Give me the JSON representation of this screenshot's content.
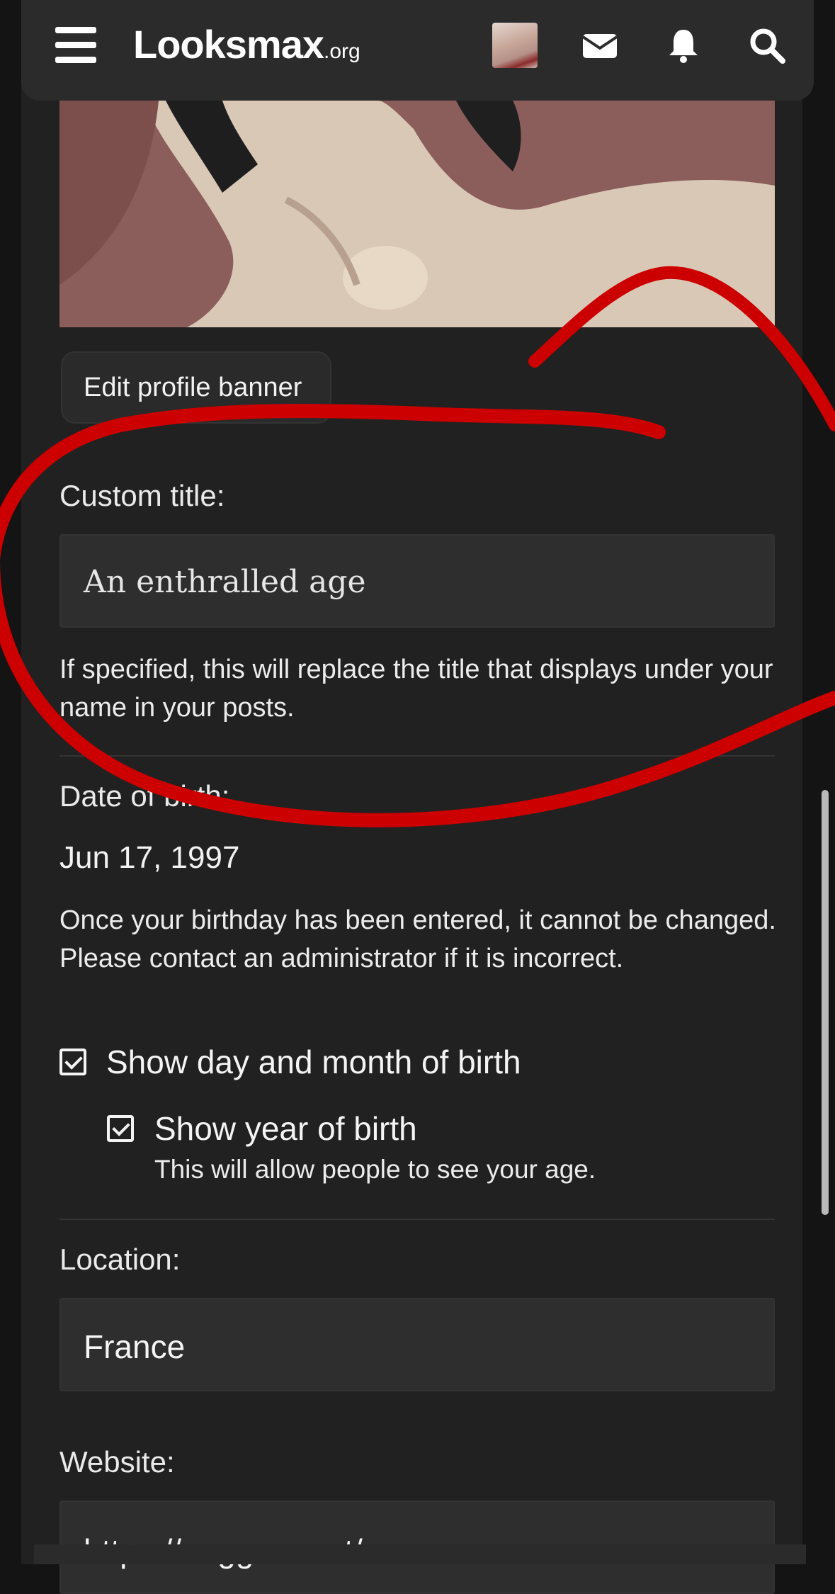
{
  "nav": {
    "logo_text": "Looksmax",
    "logo_suffix": ".org",
    "icons": [
      "menu-icon",
      "mail-icon",
      "bell-icon",
      "search-icon"
    ]
  },
  "banner": {
    "edit_button": "Edit profile banner"
  },
  "custom_title": {
    "label": "Custom title:",
    "value": "An enthralled age",
    "hint": "If specified, this will replace the title that displays under your name in your posts."
  },
  "dob": {
    "label": "Date of birth:",
    "value": "Jun 17, 1997",
    "hint": "Once your birthday has been entered, it cannot be changed. Please contact an administrator if it is incorrect."
  },
  "checkboxes": {
    "show_day_month": {
      "label": "Show day and month of birth",
      "checked": true
    },
    "show_year": {
      "label": "Show year of birth",
      "sub": "This will allow people to see your age.",
      "checked": true
    }
  },
  "location": {
    "label": "Location:",
    "value": "France"
  },
  "website": {
    "label": "Website:",
    "value": "https://naggers.net/"
  },
  "colors": {
    "background": "#212121",
    "navbar": "#2b2b2b",
    "field": "#2e2e2e",
    "annotation": "#cc0000"
  }
}
